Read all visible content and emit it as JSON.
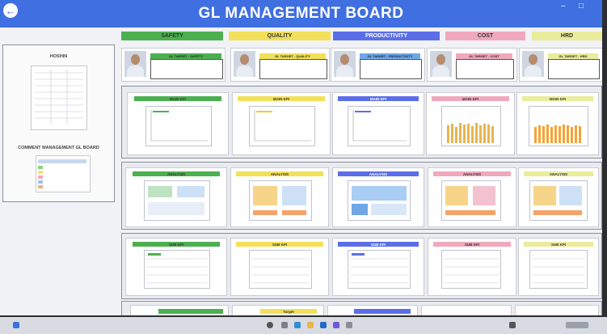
{
  "header": {
    "title": "GL MANAGEMENT BOARD"
  },
  "categories": [
    {
      "label": "SAFETY",
      "color": "#4caf50"
    },
    {
      "label": "QUALITY",
      "color": "#f2e05a"
    },
    {
      "label": "PRODUCTIVITY",
      "color": "#5b6ee8"
    },
    {
      "label": "COST",
      "color": "#f0a8bd"
    },
    {
      "label": "HRD",
      "color": "#e9ec9b"
    }
  ],
  "side": {
    "hoshin_label": "HOSHIN",
    "comment_label": "COMMENT MANAGEMENT GL BOARD"
  },
  "leaders": [
    {
      "tag": "GL TARGET - SAFETY"
    },
    {
      "tag": "GL TARGET - QUALITY"
    },
    {
      "tag": "GL TARGET - PRODUCTIVITY"
    },
    {
      "tag": "GL TARGET - COST"
    },
    {
      "tag": "GL TARGET - HRD"
    }
  ],
  "rows": [
    {
      "name": "main-kpi",
      "label": "MAIN KPI"
    },
    {
      "name": "analysis",
      "label": "ANALYSIS"
    },
    {
      "name": "sub-kpi",
      "label": "SUB KPI"
    }
  ],
  "bottom_row": {
    "tag_label": "Target"
  },
  "taskbar": {
    "icons": [
      "start-icon",
      "search-icon",
      "task-view-icon",
      "edge-icon",
      "explorer-icon",
      "mail-icon",
      "teams-icon",
      "settings-icon"
    ]
  }
}
